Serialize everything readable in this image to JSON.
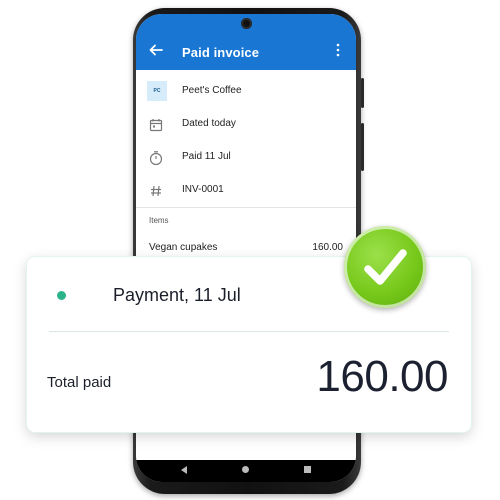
{
  "appbar": {
    "title": "Paid invoice",
    "back_icon": "arrow-left-icon",
    "menu_icon": "more-vertical-icon",
    "color": "#1976d2"
  },
  "details": {
    "vendor_avatar": "PC",
    "vendor": "Peet's Coffee",
    "date": "Dated today",
    "paid": "Paid 11 Jul",
    "invoice_number": "INV-0001"
  },
  "items_section": {
    "label": "Items",
    "items": [
      {
        "name": "Vegan cupakes",
        "price": "160.00"
      }
    ]
  },
  "payment_card": {
    "title": "Payment, 11 Jul",
    "total_label": "Total paid",
    "total_value": "160.00",
    "status_color": "#2bb38a"
  },
  "badge": {
    "icon": "checkmark-icon",
    "color": "#76c81a"
  }
}
